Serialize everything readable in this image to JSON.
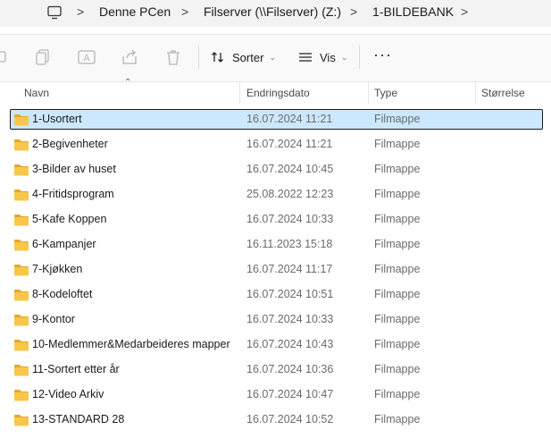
{
  "address_bar": {
    "icon": "computer-icon",
    "crumbs": [
      "Denne PCen",
      "Filserver (\\\\Filserver) (Z:)",
      "1-BILDEBANK"
    ]
  },
  "toolbar": {
    "sort_label": "Sorter",
    "view_label": "Vis",
    "more_label": "···"
  },
  "columns": {
    "name": "Navn",
    "date": "Endringsdato",
    "type": "Type",
    "size": "Størrelse"
  },
  "rows": [
    {
      "name": "1-Usortert",
      "date": "16.07.2024 11:21",
      "type": "Filmappe"
    },
    {
      "name": "2-Begivenheter",
      "date": "16.07.2024 11:21",
      "type": "Filmappe"
    },
    {
      "name": "3-Bilder av huset",
      "date": "16.07.2024 10:45",
      "type": "Filmappe"
    },
    {
      "name": "4-Fritidsprogram",
      "date": "25.08.2022 12:23",
      "type": "Filmappe"
    },
    {
      "name": "5-Kafe Koppen",
      "date": "16.07.2024 10:33",
      "type": "Filmappe"
    },
    {
      "name": "6-Kampanjer",
      "date": "16.11.2023 15:18",
      "type": "Filmappe"
    },
    {
      "name": "7-Kjøkken",
      "date": "16.07.2024 11:17",
      "type": "Filmappe"
    },
    {
      "name": "8-Kodeloftet",
      "date": "16.07.2024 10:51",
      "type": "Filmappe"
    },
    {
      "name": "9-Kontor",
      "date": "16.07.2024 10:33",
      "type": "Filmappe"
    },
    {
      "name": "10-Medlemmer&Medarbeideres mapper",
      "date": "16.07.2024 10:43",
      "type": "Filmappe"
    },
    {
      "name": "11-Sortert etter år",
      "date": "16.07.2024 10:36",
      "type": "Filmappe"
    },
    {
      "name": "12-Video Arkiv",
      "date": "16.07.2024 10:47",
      "type": "Filmappe"
    },
    {
      "name": "13-STANDARD 28",
      "date": "16.07.2024 10:52",
      "type": "Filmappe"
    }
  ],
  "selected_row": 0,
  "colors": {
    "selection": "#cce8ff",
    "folder": "#f8c74a"
  }
}
